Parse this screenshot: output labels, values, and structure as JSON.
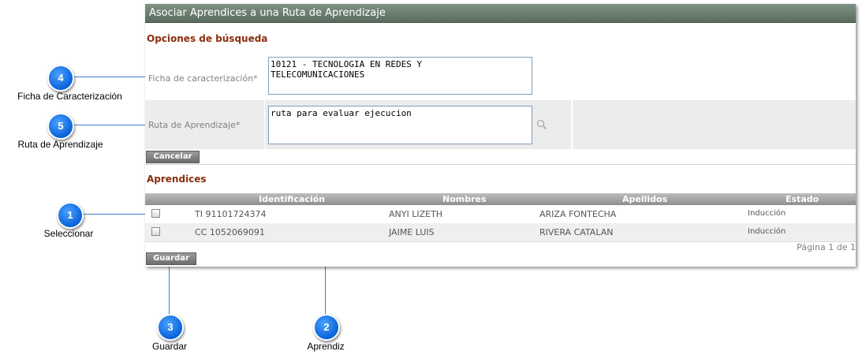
{
  "window": {
    "title": "Asociar Aprendices a una Ruta de Aprendizaje"
  },
  "search": {
    "section_title": "Opciones de búsqueda",
    "ficha_label": "Ficha de caracterización*",
    "ficha_value_line1": "10121 - TECNOLOGIA EN REDES Y",
    "ficha_value_line2": "TELECOMUNICACIONES",
    "ruta_label": "Ruta de Aprendizaje*",
    "ruta_value": "ruta para evaluar ejecucion",
    "search_icon": "magnifier-icon",
    "cancel_label": "Cancelar"
  },
  "learners": {
    "section_title": "Aprendices",
    "columns": [
      "Identificación",
      "Nombres",
      "Apellidos",
      "Estado"
    ],
    "rows": [
      {
        "id": "TI 91101724374",
        "nombres": "ANYI LIZETH",
        "apellidos": "ARIZA FONTECHA",
        "estado": "Inducción"
      },
      {
        "id": "CC 1052069091",
        "nombres": "JAIME LUIS",
        "apellidos": "RIVERA CATALAN",
        "estado": "Inducción"
      }
    ],
    "pager": "Página 1 de 1",
    "save_label": "Guardar"
  },
  "callouts": [
    {
      "number": "4",
      "label": "Ficha de Caracterización"
    },
    {
      "number": "5",
      "label": "Ruta de Aprendizaje"
    },
    {
      "number": "1",
      "label": "Seleccionar"
    },
    {
      "number": "3",
      "label": "Guardar"
    },
    {
      "number": "2",
      "label": "Aprendiz"
    }
  ],
  "colors": {
    "section_title": "#8b2e0e",
    "callout": "#0a62d8",
    "titlebar": "#6b7d6f"
  }
}
